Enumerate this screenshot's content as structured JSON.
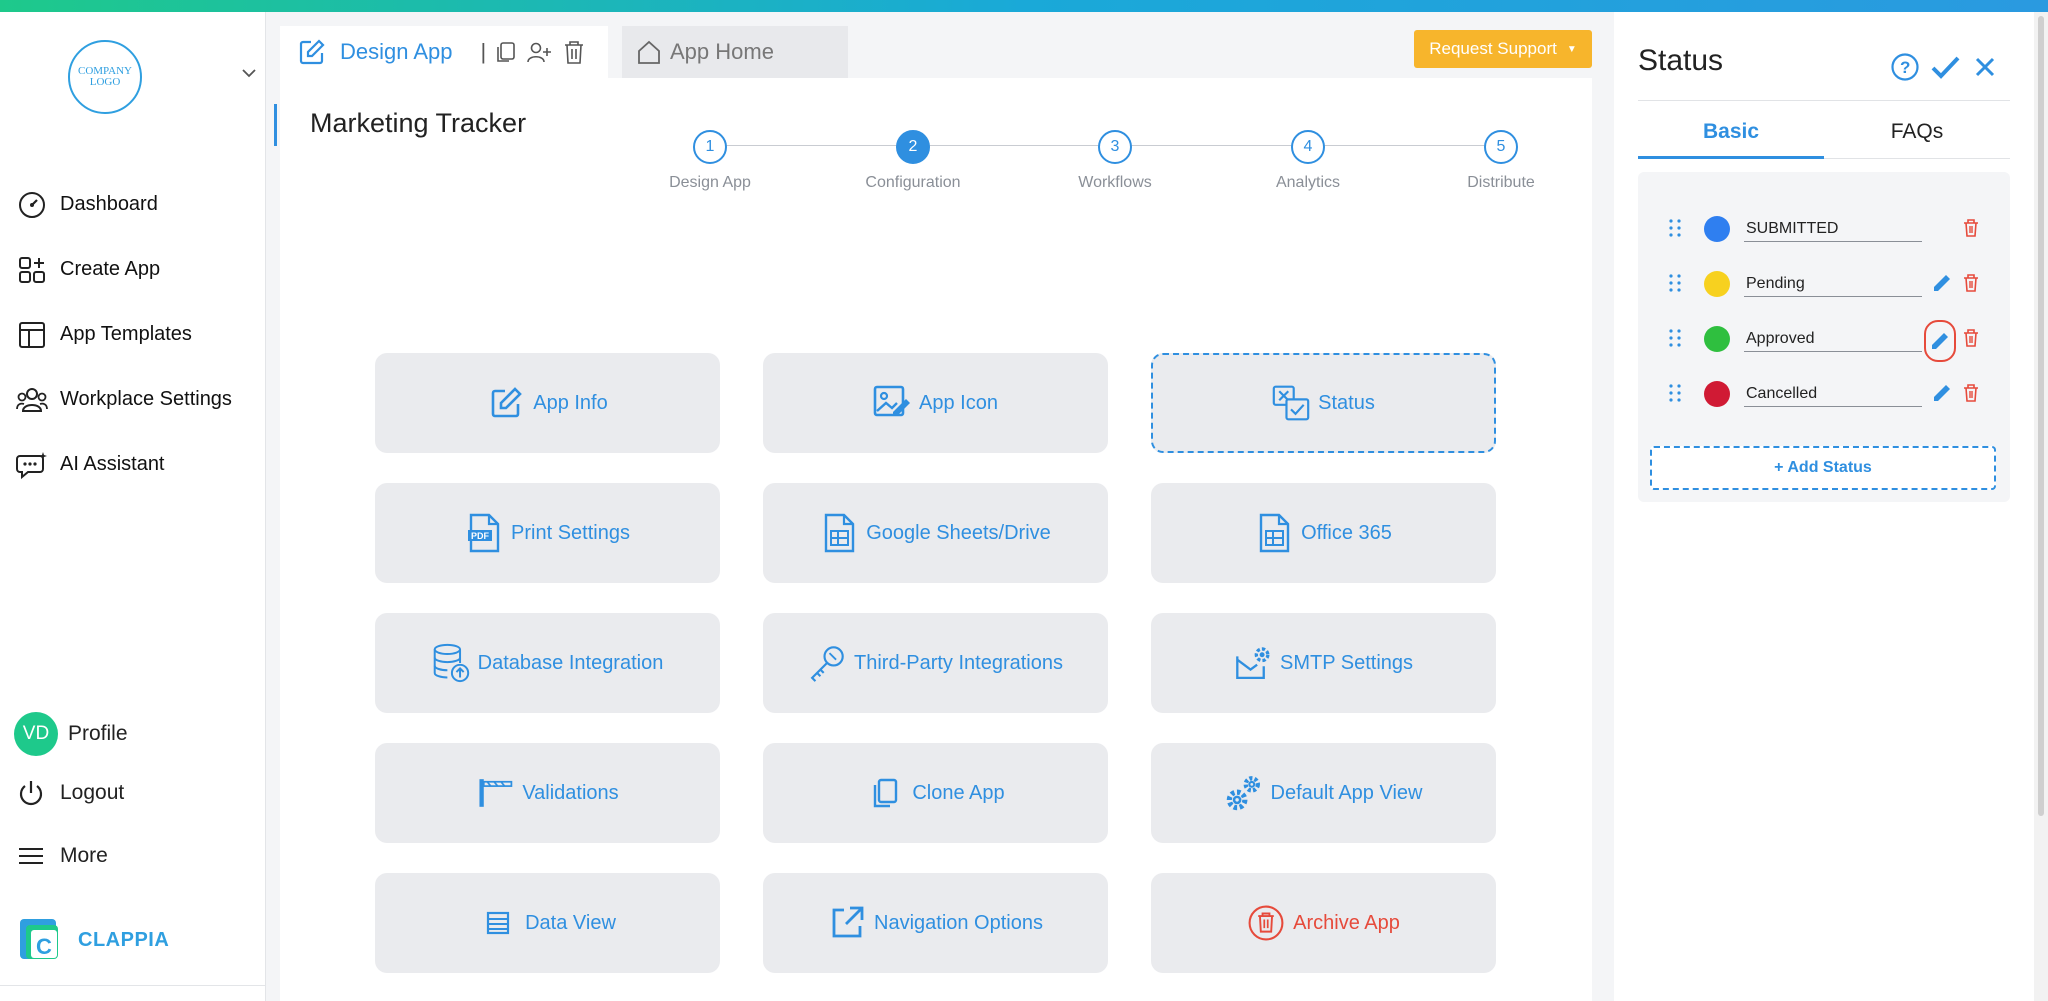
{
  "sidebar": {
    "logo_text": "COMPANY LOGO",
    "nav": [
      {
        "label": "Dashboard",
        "icon": "gauge-icon"
      },
      {
        "label": "Create App",
        "icon": "grid-plus-icon"
      },
      {
        "label": "App Templates",
        "icon": "layout-icon"
      },
      {
        "label": "Workplace Settings",
        "icon": "users-icon"
      },
      {
        "label": "AI Assistant",
        "icon": "chat-bot-icon"
      }
    ],
    "profile": {
      "initials": "VD",
      "label": "Profile"
    },
    "logout_label": "Logout",
    "more_label": "More",
    "brand_label": "CLAPPIA"
  },
  "header": {
    "design_tab": "Design App",
    "home_tab": "App Home",
    "request_support": "Request Support"
  },
  "main": {
    "app_title": "Marketing Tracker",
    "steps": [
      {
        "num": "1",
        "label": "Design App"
      },
      {
        "num": "2",
        "label": "Configuration"
      },
      {
        "num": "3",
        "label": "Workflows"
      },
      {
        "num": "4",
        "label": "Analytics"
      },
      {
        "num": "5",
        "label": "Distribute"
      }
    ],
    "cards": [
      {
        "label": "App Info",
        "icon": "edit-box-icon"
      },
      {
        "label": "App Icon",
        "icon": "image-edit-icon"
      },
      {
        "label": "Status",
        "icon": "status-check-icon"
      },
      {
        "label": "Print Settings",
        "icon": "pdf-icon"
      },
      {
        "label": "Google Sheets/Drive",
        "icon": "sheet-icon"
      },
      {
        "label": "Office 365",
        "icon": "sheet-icon"
      },
      {
        "label": "Database Integration",
        "icon": "database-icon"
      },
      {
        "label": "Third-Party Integrations",
        "icon": "key-icon"
      },
      {
        "label": "SMTP Settings",
        "icon": "mail-gear-icon"
      },
      {
        "label": "Validations",
        "icon": "barrier-icon"
      },
      {
        "label": "Clone App",
        "icon": "copy-icon"
      },
      {
        "label": "Default App View",
        "icon": "gears-icon"
      },
      {
        "label": "Data View",
        "icon": "list-icon"
      },
      {
        "label": "Navigation Options",
        "icon": "external-link-icon"
      },
      {
        "label": "Archive App",
        "icon": "trash-circle-icon"
      }
    ]
  },
  "panel": {
    "title": "Status",
    "tabs": [
      "Basic",
      "FAQs"
    ],
    "statuses": [
      {
        "name": "SUBMITTED",
        "color": "#2f7ff0"
      },
      {
        "name": "Pending",
        "color": "#f7d11f"
      },
      {
        "name": "Approved",
        "color": "#2fbf3f"
      },
      {
        "name": "Cancelled",
        "color": "#d01a34"
      }
    ],
    "add_label": "+ Add Status"
  },
  "colors": {
    "accent": "#2f8fe0",
    "warning": "#f7b52c",
    "danger": "#e64a3b",
    "brand_green": "#1ec98b"
  }
}
